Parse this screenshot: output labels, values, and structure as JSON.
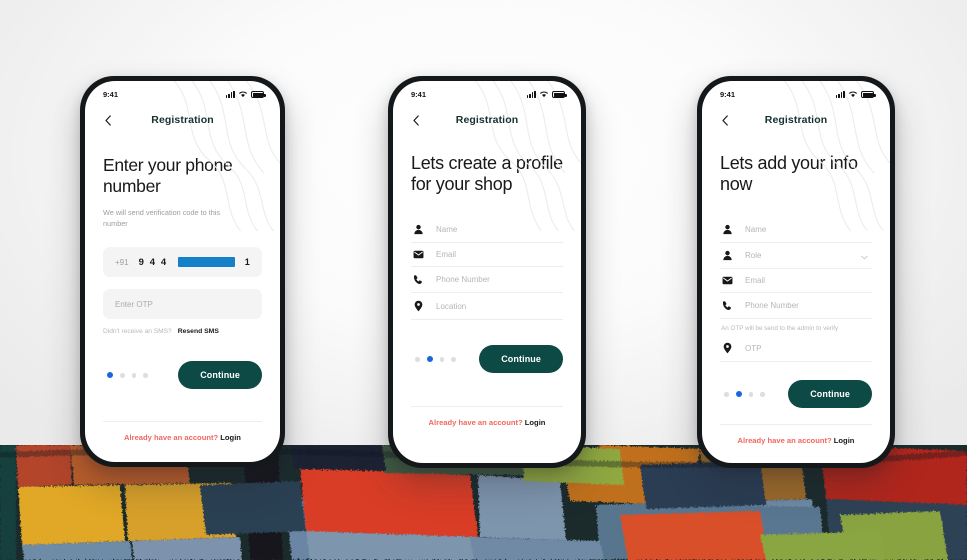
{
  "app": {
    "accent_teal": "#0d4a46",
    "accent_blue": "#1a66dd",
    "accent_red": "#f2665f",
    "redaction_blue": "#1580c8"
  },
  "status_bar": {
    "time": "9:41",
    "signal_icon": "signal-bars-icon",
    "wifi_icon": "wifi-icon",
    "battery_icon": "battery-icon"
  },
  "footer_link": {
    "prefix": "Already have an account?",
    "action": "Login"
  },
  "screens": [
    {
      "nav": {
        "back_icon": "chevron-left-icon",
        "title": "Registration"
      },
      "headline": "Enter your phone number",
      "subline": "We will send verification code to this number",
      "phone_field": {
        "country_code": "+91",
        "visible_digits": "9 4 4",
        "redacted": true,
        "trailing_digit": "1"
      },
      "otp_field": {
        "placeholder": "Enter OTP",
        "value": ""
      },
      "resend": {
        "question": "Didn't receive an SMS?",
        "action": "Resend SMS"
      },
      "dots": {
        "count": 4,
        "active": 0
      },
      "continue_label": "Continue"
    },
    {
      "nav": {
        "back_icon": "chevron-left-icon",
        "title": "Registration"
      },
      "headline": "Lets create a profile for your shop",
      "fields": [
        {
          "icon": "person-icon",
          "placeholder": "Name",
          "value": ""
        },
        {
          "icon": "envelope-icon",
          "placeholder": "Email",
          "value": ""
        },
        {
          "icon": "phone-icon",
          "placeholder": "Phone Number",
          "value": ""
        },
        {
          "icon": "location-pin-icon",
          "placeholder": "Location",
          "value": ""
        }
      ],
      "dots": {
        "count": 4,
        "active": 1
      },
      "continue_label": "Continue"
    },
    {
      "nav": {
        "back_icon": "chevron-left-icon",
        "title": "Registration"
      },
      "headline": "Lets add your info now",
      "fields": [
        {
          "icon": "person-icon",
          "placeholder": "Name",
          "value": ""
        },
        {
          "icon": "person-icon",
          "placeholder": "Role",
          "value": "",
          "dropdown": true,
          "dropdown_icon": "chevron-down-icon"
        },
        {
          "icon": "envelope-icon",
          "placeholder": "Email",
          "value": ""
        },
        {
          "icon": "phone-icon",
          "placeholder": "Phone Number",
          "value": ""
        }
      ],
      "otp_note": "An OTP will be send to the admin  to verify",
      "otp_field": {
        "icon": "location-pin-icon",
        "placeholder": "OTP",
        "value": ""
      },
      "dots": {
        "count": 4,
        "active": 1
      },
      "continue_label": "Continue"
    }
  ]
}
